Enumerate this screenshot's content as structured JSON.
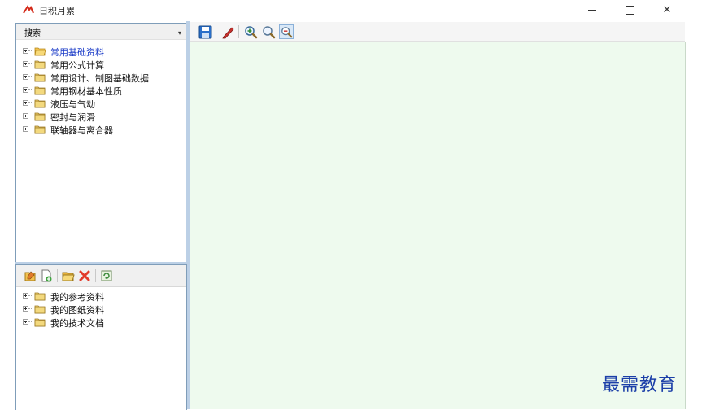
{
  "window": {
    "title": "日积月累",
    "controls": {
      "minimize": "—",
      "close": "✕"
    }
  },
  "search": {
    "label": "搜索"
  },
  "tree_top": [
    {
      "label": "常用基础资料",
      "selected": true
    },
    {
      "label": "常用公式计算"
    },
    {
      "label": "常用设计、制图基础数据"
    },
    {
      "label": "常用钢材基本性质"
    },
    {
      "label": "液压与气动"
    },
    {
      "label": "密封与润滑"
    },
    {
      "label": "联轴器与离合器"
    }
  ],
  "tree_bottom": [
    {
      "label": "我的参考资料"
    },
    {
      "label": "我的图纸资料"
    },
    {
      "label": "我的技术文档"
    }
  ],
  "right_toolbar_icons": [
    "save-icon",
    "pen-icon",
    "zoom-in-icon",
    "zoom-icon",
    "zoom-fit-icon"
  ],
  "left_toolbar_icons": [
    "edit-icon",
    "new-doc-icon",
    "open-folder-icon",
    "delete-icon",
    "refresh-icon"
  ],
  "colors": {
    "accent_blue": "#1e3ec8",
    "viewer_bg": "#eefaee",
    "splitter": "#bcd0e6",
    "close_red": "#e23a2a"
  },
  "watermark": "最需教育"
}
